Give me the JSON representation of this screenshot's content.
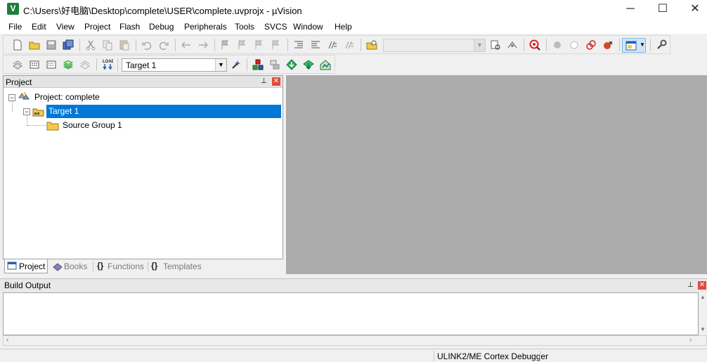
{
  "window": {
    "title": "C:\\Users\\好电脑\\Desktop\\complete\\USER\\complete.uvprojx - µVision"
  },
  "menu": [
    "File",
    "Edit",
    "View",
    "Project",
    "Flash",
    "Debug",
    "Peripherals",
    "Tools",
    "SVCS",
    "Window",
    "Help"
  ],
  "build_toolbar": {
    "target_select": "Target 1"
  },
  "project_panel": {
    "title": "Project",
    "tree": {
      "project": "Project: complete",
      "target": "Target 1",
      "group": "Source Group 1"
    },
    "tabs": [
      "Project",
      "Books",
      "Functions",
      "Templates"
    ]
  },
  "build_output": {
    "title": "Build Output"
  },
  "status": {
    "debugger": "ULINK2/ME Cortex Debugger"
  },
  "colors": {
    "selection": "#0078d7",
    "editor_bg": "#ababab"
  }
}
